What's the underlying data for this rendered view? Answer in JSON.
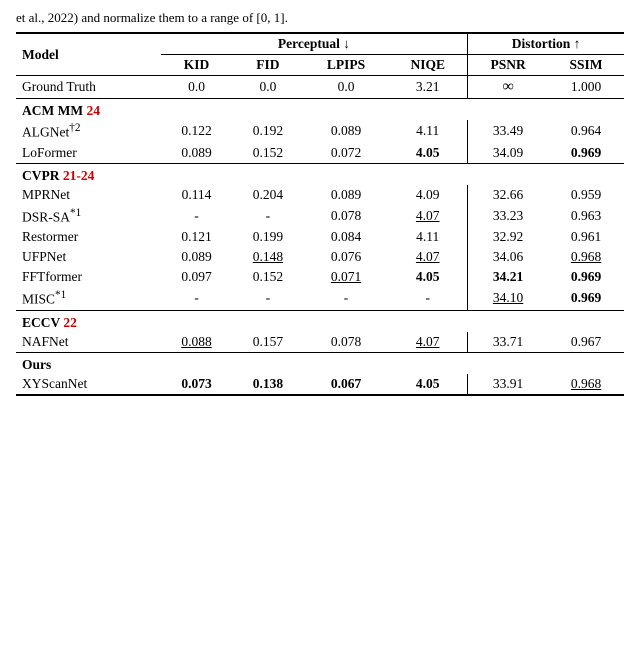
{
  "intro": {
    "text": "et al., 2022) and normalize them to a range of [0, 1]."
  },
  "table": {
    "col_groups": [
      {
        "label": "Perceptual",
        "arrow": "down",
        "colspan": 4
      },
      {
        "label": "Distortion",
        "arrow": "up",
        "colspan": 2
      }
    ],
    "cols": [
      "Model",
      "KID",
      "FID",
      "LPIPS",
      "NIQE",
      "PSNR",
      "SSIM"
    ],
    "sections": [
      {
        "type": "single",
        "rows": [
          {
            "model": "Ground Truth",
            "kid": "0.0",
            "fid": "0.0",
            "lpips": "0.0",
            "niqe": "3.21",
            "psnr": "∞",
            "ssim": "1.000",
            "styles": {
              "psnr": "inf"
            }
          }
        ]
      },
      {
        "type": "group",
        "header": "ACM MM",
        "header_suffix": "24",
        "header_color": "red",
        "rows": [
          {
            "model": "ALGNet†2",
            "kid": "0.122",
            "fid": "0.192",
            "lpips": "0.089",
            "niqe": "4.11",
            "psnr": "33.49",
            "ssim": "0.964"
          },
          {
            "model": "LoFormer",
            "kid": "0.089",
            "fid": "0.152",
            "lpips": "0.072",
            "niqe": "4.05",
            "psnr": "34.09",
            "ssim": "0.969",
            "styles": {
              "niqe": "bold",
              "ssim": "bold"
            }
          }
        ]
      },
      {
        "type": "group",
        "header": "CVPR",
        "header_suffix": "21-24",
        "header_color": "red",
        "rows": [
          {
            "model": "MPRNet",
            "kid": "0.114",
            "fid": "0.204",
            "lpips": "0.089",
            "niqe": "4.09",
            "psnr": "32.66",
            "ssim": "0.959"
          },
          {
            "model": "DSR-SA*1",
            "kid": "-",
            "fid": "-",
            "lpips": "0.078",
            "niqe": "4.07",
            "psnr": "33.23",
            "ssim": "0.963",
            "styles": {
              "niqe": "underline"
            }
          },
          {
            "model": "Restormer",
            "kid": "0.121",
            "fid": "0.199",
            "lpips": "0.084",
            "niqe": "4.11",
            "psnr": "32.92",
            "ssim": "0.961"
          },
          {
            "model": "UFPNet",
            "kid": "0.089",
            "fid": "0.148",
            "lpips": "0.076",
            "niqe": "4.07",
            "psnr": "34.06",
            "ssim": "0.968",
            "styles": {
              "fid": "underline",
              "niqe": "underline",
              "ssim": "underline"
            }
          },
          {
            "model": "FFTformer",
            "kid": "0.097",
            "fid": "0.152",
            "lpips": "0.071",
            "niqe": "4.05",
            "psnr": "34.21",
            "ssim": "0.969",
            "styles": {
              "lpips": "underline",
              "niqe": "bold",
              "psnr": "bold",
              "ssim": "bold"
            }
          },
          {
            "model": "MISC*1",
            "kid": "-",
            "fid": "-",
            "lpips": "-",
            "niqe": "-",
            "psnr": "34.10",
            "ssim": "0.969",
            "styles": {
              "psnr": "underline",
              "ssim": "bold"
            }
          }
        ]
      },
      {
        "type": "group",
        "header": "ECCV",
        "header_suffix": "22",
        "header_color": "red",
        "rows": [
          {
            "model": "NAFNet",
            "kid": "0.088",
            "fid": "0.157",
            "lpips": "0.078",
            "niqe": "4.07",
            "psnr": "33.71",
            "ssim": "0.967",
            "styles": {
              "kid": "underline",
              "niqe": "underline"
            }
          }
        ]
      },
      {
        "type": "group",
        "header": "Ours",
        "header_color": "black",
        "rows": [
          {
            "model": "XYScanNet",
            "kid": "0.073",
            "fid": "0.138",
            "lpips": "0.067",
            "niqe": "4.05",
            "psnr": "33.91",
            "ssim": "0.968",
            "styles": {
              "kid": "bold",
              "fid": "bold",
              "lpips": "bold",
              "niqe": "bold",
              "ssim": "underline"
            }
          }
        ]
      }
    ]
  }
}
